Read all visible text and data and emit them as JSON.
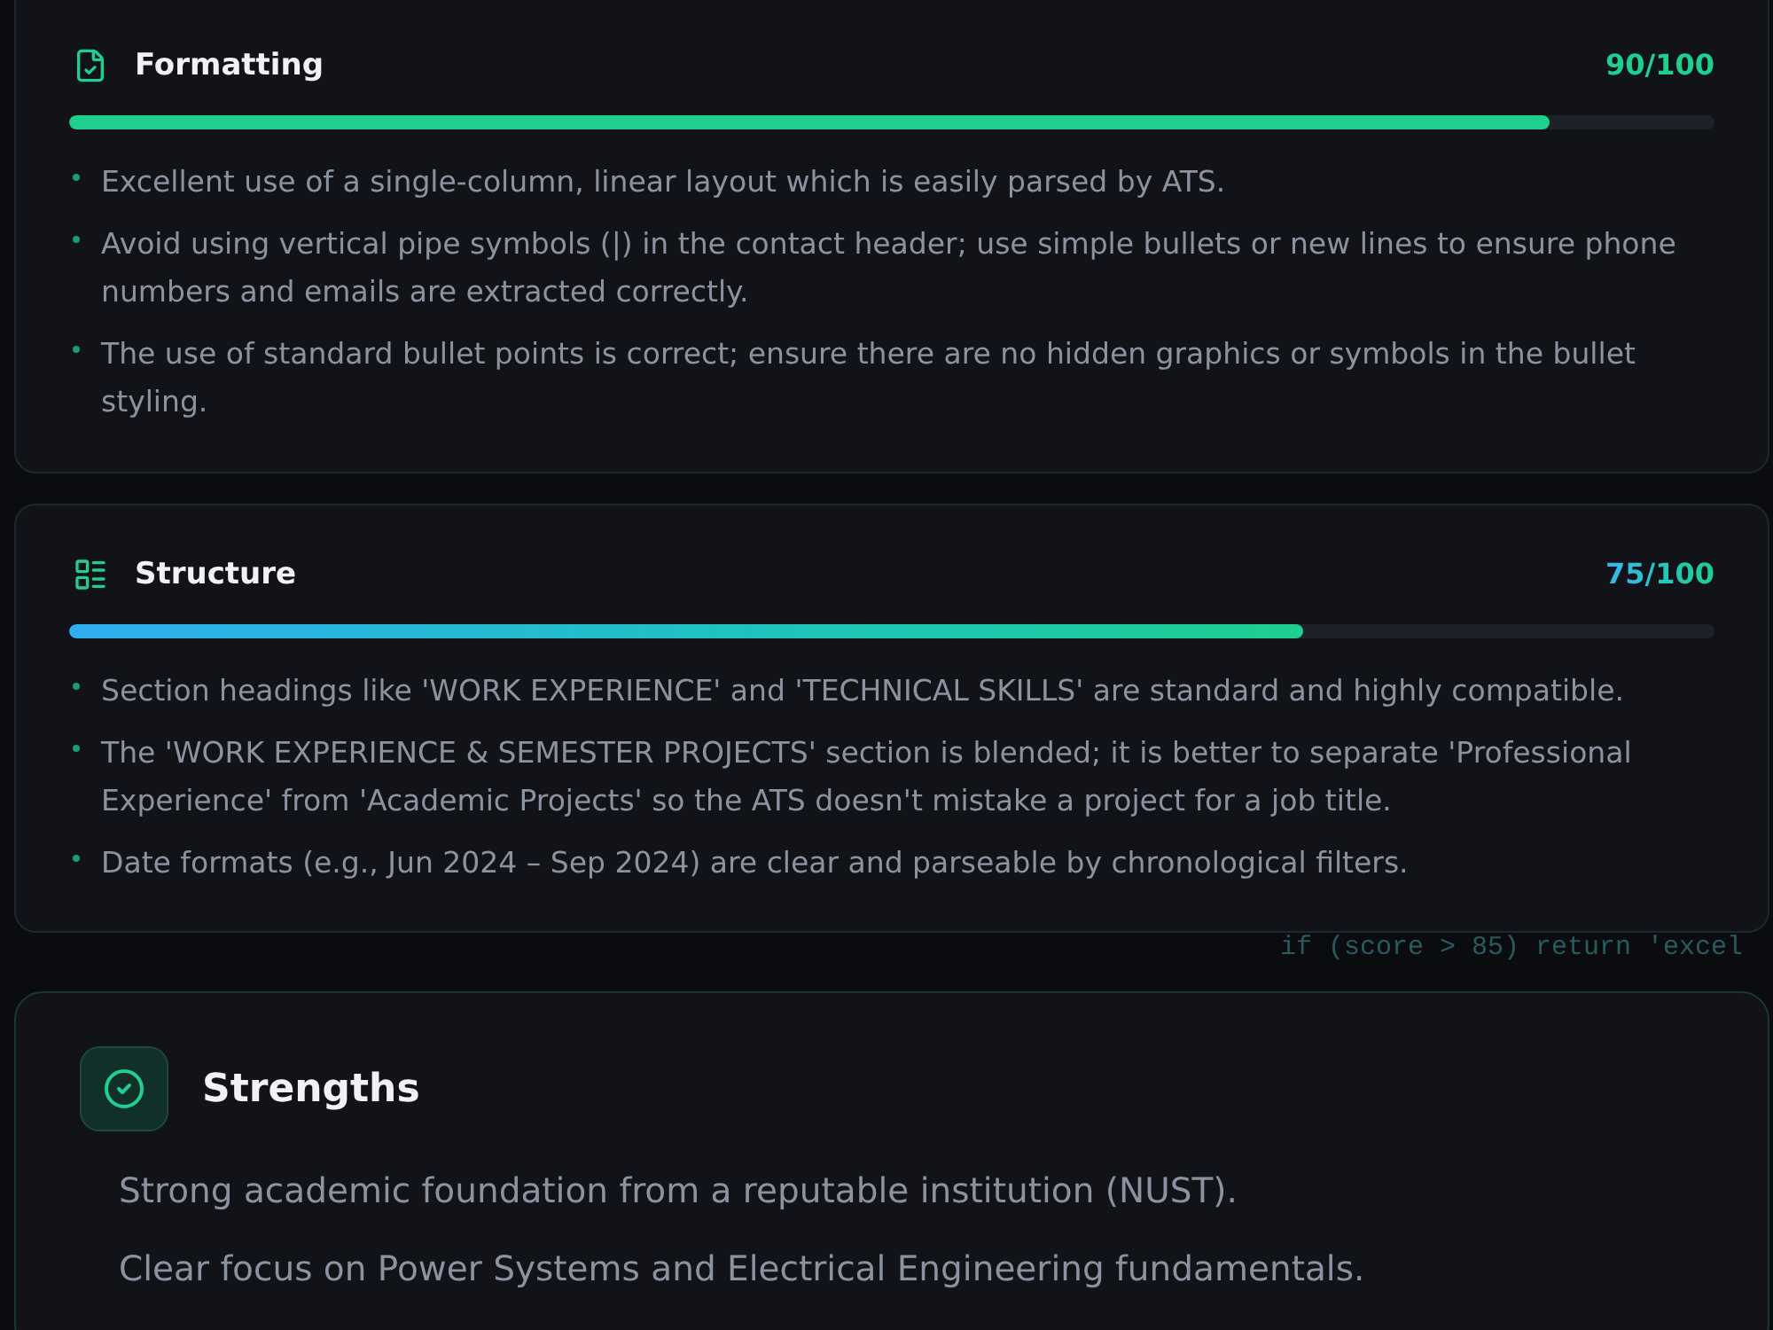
{
  "sections": [
    {
      "title": "Formatting",
      "score": "90/100",
      "level": 0.9,
      "items": [
        "Excellent use of a single-column, linear layout which is easily parsed by ATS.",
        "Avoid using vertical pipe symbols (|) in the contact header; use simple bullets or new lines to ensure phone numbers and emails are extracted correctly.",
        "The use of standard bullet points is correct; ensure there are no hidden graphics or symbols in the bullet styling."
      ]
    },
    {
      "title": "Structure",
      "score": "75/100",
      "level": 0.75,
      "items": [
        "Section headings like 'WORK EXPERIENCE' and 'TECHNICAL SKILLS' are standard and highly compatible.",
        "The 'WORK EXPERIENCE & SEMESTER PROJECTS' section is blended; it is better to separate 'Professional Experience' from 'Academic Projects' so the ATS doesn't mistake a project for a job title.",
        "Date formats (e.g., Jun 2024 – Sep 2024) are clear and parseable by chronological filters."
      ]
    }
  ],
  "background_code": "if (score > 85) return 'excel",
  "strengths": {
    "title": "Strengths",
    "items": [
      "Strong academic foundation from a reputable institution (NUST).",
      "Clear focus on Power Systems and Electrical Engineering fundamentals."
    ]
  }
}
